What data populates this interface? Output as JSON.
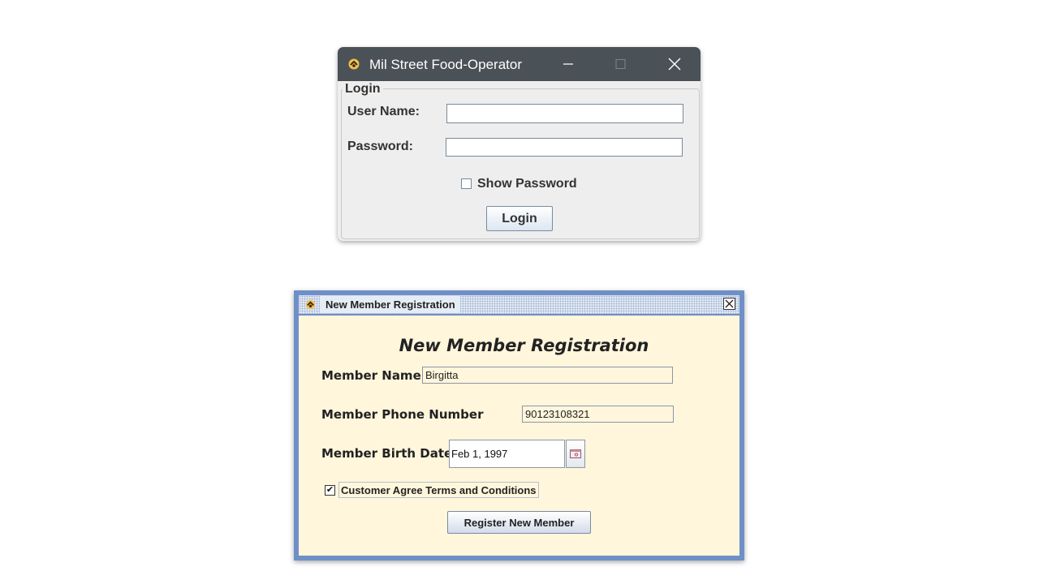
{
  "login_window": {
    "title": "Mil Street Food-Operator",
    "app_icon": "app-icon",
    "controls": {
      "minimize_icon": "minimize-icon",
      "maximize_icon": "maximize-icon",
      "close_icon": "close-icon"
    },
    "group_title": "Login",
    "username": {
      "label": "User Name:",
      "value": ""
    },
    "password": {
      "label": "Password:",
      "value": ""
    },
    "show_password": {
      "label": "Show Password",
      "checked": false
    },
    "login_button": "Login"
  },
  "registration_window": {
    "title": "New Member Registration",
    "heading": "New Member Registration",
    "member_name": {
      "label": "Member Name",
      "value": "Birgitta"
    },
    "phone": {
      "label": "Member Phone Number",
      "value": "90123108321"
    },
    "birth_date": {
      "label": "Member Birth Date",
      "value": "Feb 1, 1997",
      "picker_icon": "calendar-icon"
    },
    "agree_terms": {
      "label": "Customer Agree Terms and Conditions",
      "checked": true,
      "check_mark": "✔"
    },
    "register_button": "Register New Member"
  },
  "colors": {
    "login_titlebar": "#4a5157",
    "login_body": "#eeeeee",
    "reg_border": "#6f8fc7",
    "reg_body": "#fff6dc"
  }
}
